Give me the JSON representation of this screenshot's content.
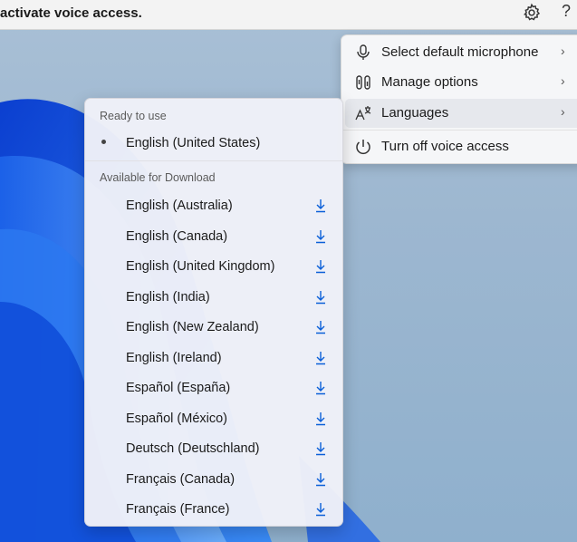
{
  "topbar": {
    "status_text": "activate voice access.",
    "settings_icon": "gear-icon",
    "help_label": "?"
  },
  "menu": {
    "items": [
      {
        "label": "Select default microphone",
        "icon": "microphone-icon",
        "has_submenu": true
      },
      {
        "label": "Manage options",
        "icon": "options-icon",
        "has_submenu": true
      },
      {
        "label": "Languages",
        "icon": "language-icon",
        "has_submenu": true,
        "active": true
      },
      {
        "label": "Turn off voice access",
        "icon": "power-icon",
        "has_submenu": false
      }
    ],
    "chevron": "›"
  },
  "languages": {
    "ready_header": "Ready to use",
    "ready": [
      {
        "label": "English (United States)"
      }
    ],
    "download_header": "Available for Download",
    "available": [
      {
        "label": "English (Australia)"
      },
      {
        "label": "English (Canada)"
      },
      {
        "label": "English (United Kingdom)"
      },
      {
        "label": "English (India)"
      },
      {
        "label": "English (New Zealand)"
      },
      {
        "label": "English (Ireland)"
      },
      {
        "label": "Español (España)"
      },
      {
        "label": "Español (México)"
      },
      {
        "label": "Deutsch (Deutschland)"
      },
      {
        "label": "Français (Canada)"
      },
      {
        "label": "Français (France)"
      }
    ]
  },
  "colors": {
    "accent": "#0a5fd8",
    "wallpaper": "#1f6be6"
  }
}
